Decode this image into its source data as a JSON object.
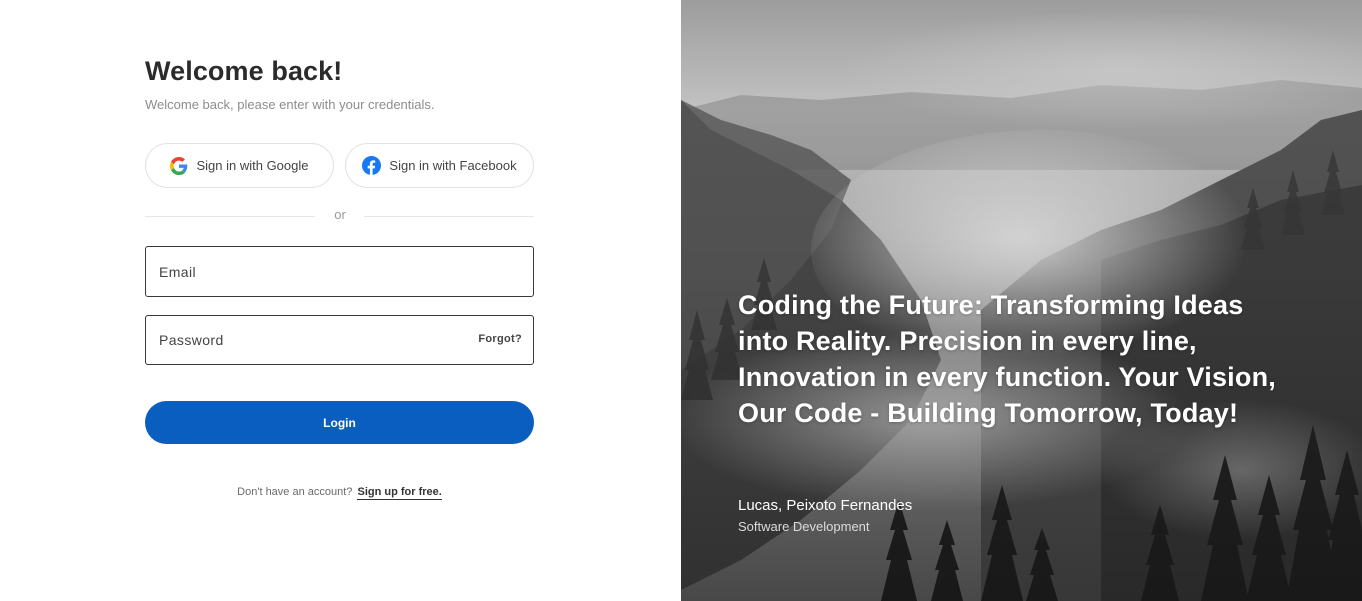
{
  "login": {
    "title": "Welcome back!",
    "subtitle": "Welcome back, please enter with your credentials.",
    "google_label": "Sign in with Google",
    "facebook_label": "Sign in with Facebook",
    "divider_text": "or",
    "email_placeholder": "Email",
    "password_placeholder": "Password",
    "forgot_label": "Forgot?",
    "login_label": "Login",
    "signup_prompt": "Don't have an account?",
    "signup_link": "Sign up for free."
  },
  "hero": {
    "quote": "Coding the Future: Transforming Ideas into Reality. Precision in every line, Innovation in every function. Your Vision, Our Code - Building Tomorrow, Today!",
    "author_name": "Lucas, Peixoto Fernandes",
    "author_role": "Software Development",
    "image": "misty-forest-grayscale"
  },
  "icons": {
    "google": "google-icon",
    "facebook": "facebook-icon"
  },
  "colors": {
    "primary": "#0a5ec0",
    "facebook": "#1877f2",
    "heading": "#2b2b2b"
  }
}
